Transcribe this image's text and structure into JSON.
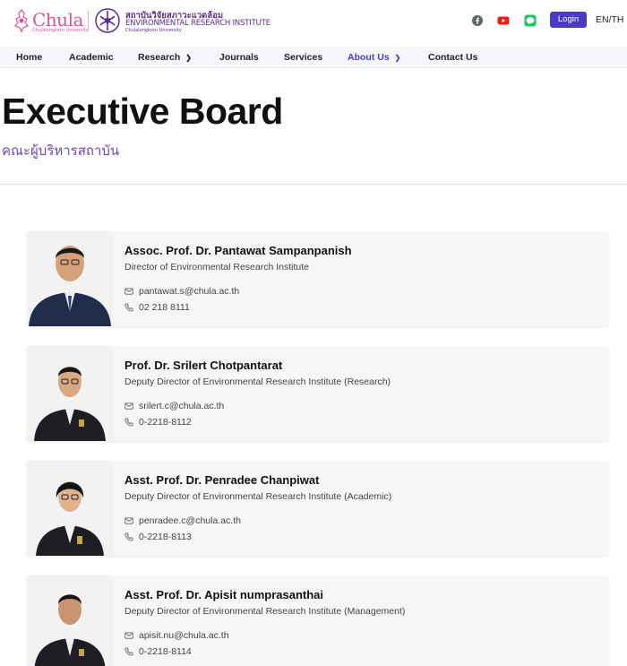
{
  "header": {
    "chula_logo_text": "Chula",
    "chula_logo_sub": "Chulalongkorn University",
    "institute_thai": "สถาบันวิจัยสภาวะแวดล้อม",
    "institute_en": "ENVIRONMENTAL RESEARCH INSTITUTE",
    "institute_sub": "Chulalongkorn University",
    "social_icons": [
      "facebook-icon",
      "youtube-icon",
      "line-icon"
    ],
    "login_label": "Login",
    "lang_label": "EN/TH",
    "colors": {
      "accent": "#4b3bc4",
      "brand_pink": "#d9539b",
      "brand_purple": "#5b2d8a",
      "youtube": "#e62117",
      "line": "#22c55e"
    }
  },
  "nav": {
    "items": [
      {
        "label": "Home",
        "has_dropdown": false,
        "active": false
      },
      {
        "label": "Academic",
        "has_dropdown": false,
        "active": false
      },
      {
        "label": "Research",
        "has_dropdown": true,
        "active": false
      },
      {
        "label": "Journals",
        "has_dropdown": false,
        "active": false
      },
      {
        "label": "Services",
        "has_dropdown": false,
        "active": false
      },
      {
        "label": "About Us",
        "has_dropdown": true,
        "active": true
      },
      {
        "label": "Contact Us",
        "has_dropdown": false,
        "active": false
      }
    ]
  },
  "page": {
    "title": "Executive Board",
    "subtitle": "คณะผู้บริหารสถาบัน"
  },
  "board": [
    {
      "name": "Assoc. Prof. Dr. Pantawat Sampanpanish",
      "position": "Director of Environmental Research Institute",
      "email": "pantawat.s@chula.ac.th",
      "phone": "02 218 8111"
    },
    {
      "name": "Prof. Dr. Srilert Chotpantarat",
      "position": "Deputy Director of Environmental Research Institute (Research)",
      "email": "srilert.c@chula.ac.th",
      "phone": "0-2218-8112"
    },
    {
      "name": "Asst. Prof. Dr. Penradee Chanpiwat",
      "position": "Deputy Director of Environmental Research Institute (Academic)",
      "email": "penradee.c@chula.ac.th",
      "phone": "0-2218-8113"
    },
    {
      "name": "Asst. Prof. Dr. Apisit numprasanthai",
      "position": "Deputy Director of Environmental Research Institute (Management)",
      "email": "apisit.nu@chula.ac.th",
      "phone": "0-2218-8114"
    }
  ]
}
